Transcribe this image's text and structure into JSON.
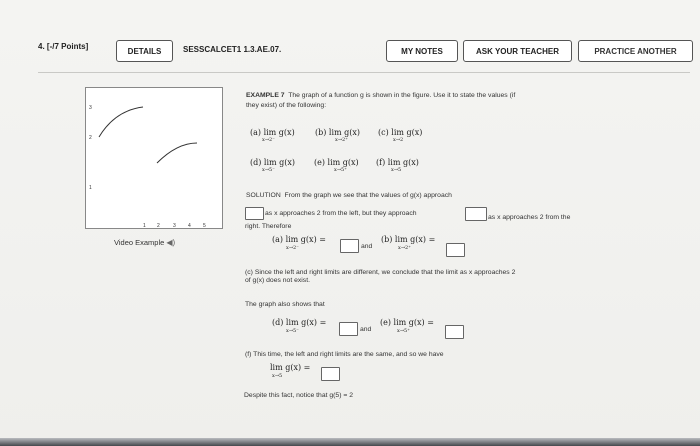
{
  "header": {
    "question_number": "4.",
    "points": "[-/7 Points]",
    "details_button": "DETAILS",
    "course_code": "SESSCALCET1 1.3.AE.07.",
    "my_notes_button": "MY NOTES",
    "ask_teacher_button": "ASK YOUR TEACHER",
    "practice_button": "PRACTICE ANOTHER"
  },
  "graph": {
    "y_ticks": [
      "3",
      "2",
      "1"
    ],
    "x_ticks": [
      "1",
      "2",
      "3",
      "4",
      "5"
    ]
  },
  "video_label": "Video Example",
  "example": {
    "heading": "EXAMPLE 7",
    "intro_line1": "The graph of a function g is shown in the figure. Use it to state the values (if",
    "intro_line2": "they exist) of the following:",
    "lim_a_label": "(a)",
    "lim_b_label": "(b)",
    "lim_c_label": "(c)",
    "lim_d_label": "(d)",
    "lim_e_label": "(e)",
    "lim_f_label": "(f)",
    "lim_text": "lim g(x)",
    "sub_2minus": "x→2⁻",
    "sub_2plus": "x→2⁺",
    "sub_2": "x→2",
    "sub_5minus": "x→5⁻",
    "sub_5plus": "x→5⁺",
    "sub_5": "x→5"
  },
  "solution": {
    "heading": "SOLUTION",
    "line1": "From the graph we see that the values of g(x) approach",
    "line2a": "as x approaches 2 from the left, but they approach",
    "line2b": "as x approaches 2 from the",
    "line3": "right. Therefore",
    "and": "and",
    "equals": "=",
    "c_line1": "(c) Since the left and right limits are different, we conclude that the limit as x approaches 2",
    "c_line2": "of g(x) does not exist.",
    "graph_also": "The graph also shows that",
    "f_line": "(f) This time, the left and right limits are the same, and so we have",
    "despite": "Despite this fact, notice that g(5) = 2"
  }
}
